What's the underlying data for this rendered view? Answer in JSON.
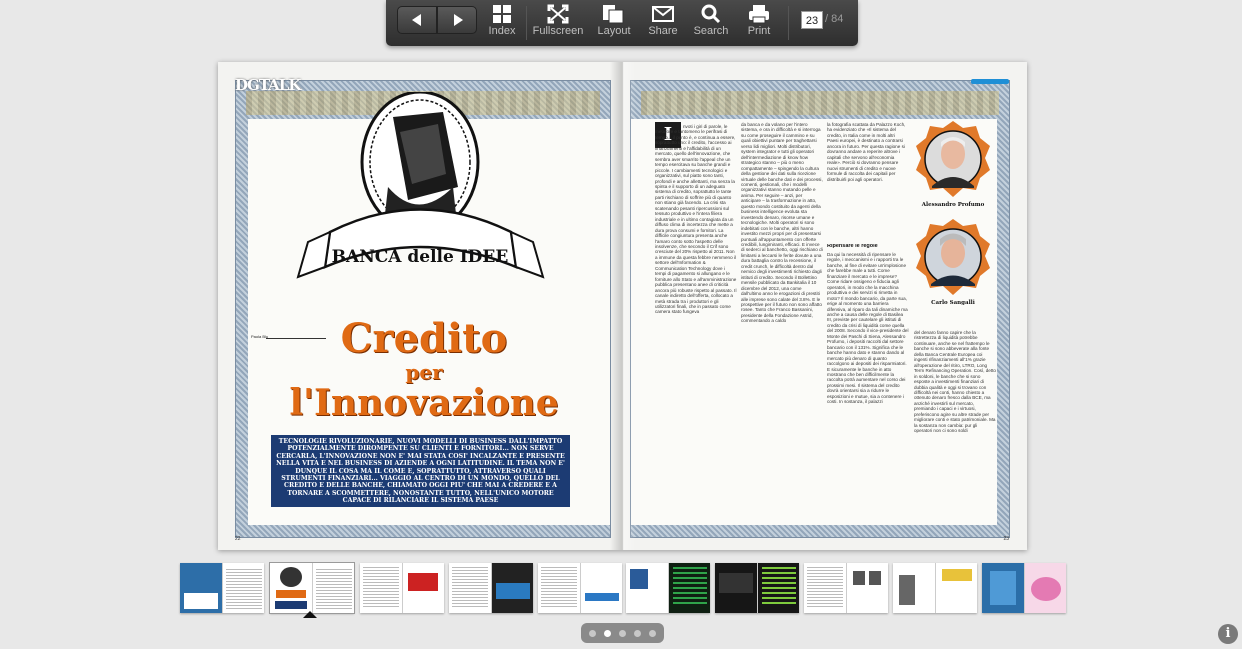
{
  "toolbar": {
    "index_label": "Index",
    "fullscreen_label": "Fullscreen",
    "layout_label": "Layout",
    "share_label": "Share",
    "search_label": "Search",
    "print_label": "Print",
    "current_page": "23",
    "total_pages": "/ 84"
  },
  "magazine": {
    "section_logo": "DGTALK",
    "left_page_number": "22",
    "right_page_number": "23",
    "illustration_banner": "BANCA delle IDEE",
    "author": "Paola Blu",
    "headline_line1": "Credito",
    "headline_line2": "per",
    "headline_line3": "l'Innovazione",
    "subhead": "TECNOLOGIE RIVOLUZIONARIE, NUOVI MODELLI DI BUSINESS DALL'IMPATTO POTENZIALMENTE DIROMPENTE SU CLIENTI E FORNITORI... NON SERVE CERCARLA, L'INNOVAZIONE NON E' MAI STATA COSI' INCALZANTE E PRESENTE NELLA VITA E NEL BUSINESS DI AZIENDE A OGNI LATITUDINE. IL TEMA NON E' DUNQUE IL COSA MA IL COME E, SOPRATTUTTO, ATTRAVERSO QUALI STRUMENTI FINANZIARI... VIAGGIO AL CENTRO DI UN MONDO, QUELLO DEL CREDITO E DELLE BANCHE, CHIAMATO OGGI PIU' CHE MAI A CREDERE E A TORNARE A SCOMMETTERE, NONOSTANTE TUTTO, NELL'UNICO MOTORE CAPACE DI RILANCIARE IL SISTEMA PAESE",
    "dropcap": "I",
    "col1": "nvoti i giri di parole, le metafore e tantomeno le perifrasi di tempo... il punto è, e continua a essere, soprattutto uno: il credito, l'accesso ai finanziamenti e l'affidabilità di un mercato, quello dell'innovazione, che sembra aver smarrito l'appeal che un tempo esercitava su banche grandi e piccole. I cambiamenti tecnologici e organizzativi, sul piatto sono tanti, profondi e anche allettanti, ma senza la spinta e il supporto di un adeguato sistema di credito, soprattutto le tante parti rischiano di soffrire più di quanto non stiano già facendo. La crisi sta scatenando pesanti ripercussioni sul tessuto produttivo e l'intera filiera industriale e in ultimo contagiata da un diffuso clima di incertezza che mette a dura prova consumi e fornitori. La difficile congiuntura presenta anche l'amaro conto sotto l'aspetto delle insolvenze, che secondo il Crif sono cresciute del 20% rispetto al 2011. Non a immune da questa febbre nemmeno il settore dell'Information & Communication Technology dove i tempi di pagamento si allungano e le forniture allo Stato e all'amministrazione pubblica presentano anee di criticità ancora più robuste rispetto al passato. Il canale indiretto dell'offerta, collocato a metà strada tra i produttori e gli utilizzatori finali, che in passato come camera stato fungeva",
    "col2": "da banca e da volano per l'intero sistema, e ora in difficoltà e si interroga su come proseguire il cammino e su quali obiettivi puntare per traghettarsi verso lidi migliori. Molti distributori, system integrator e tutti gli operatori dell'intermediazione di know how strategico stanno – più o meno compattamente – spingendo la cultura della gestione dei dati sulla ricezione virtuale delle banche dati e dei processi, comenti, gestionali, che i modelli organizzativi stanno mutando pelle e anima. Per seguire – anzi, per anticipare – la trasformazione in atto, questo mondo costituito da agenti della business intelligence evoluta sta investendo denaro, risorse umane e tecnologiche. Molti operatori si sono indebitati con le banche, altri hanno investito mezzi propri per di presentarsi puntuali all'appuntamento con offerte credibili, lungimiranti, efficaci. E invece di sederci al banchetto, oggi rischiano di limitarsi a leccarsi le ferite dovute a una dura battaglia contro la recessione, il credit crunch, le difficoltà dentro dal nemico degli investimenti richiesto dagli istituti di credito. Secondo il Bollettino mensile pubblicato da Bankitalia il 10 dicembre del 2012, una come dall'ultimo anno le erogazioni di prestiti alle imprese sono calate del 3.8%. E le prospettive per il futuro non sono affatto rosee. Tanto che Franco Bassanini, presidente della Fondazione Astrid, commentando a caldo",
    "col3": "la fotografia scattata da Palazzo Koch, ha evidenziato che «Il sistema del credito, in Italia come in molti altri Paesi europei, è destinato a contrarsi ancora in futuro. Per questa ragione si dovranno andare a reperire altrove i capitali che servono all'economia reale». Perciò si dovranno pensare nuovi strumenti di credito e nuove formule di raccolta dei capitali per distribuirli poi agli operatori.",
    "col3_head": "Ripensare le regole",
    "col3_b": "Da qui la necessità di ripensare le regole, i meccanismi e i rapporti tra le banche, al fine di evitare un'implosione che farebbe male a tutti. Come finanziare il mercato e le imprese? Come ridare ossigeno e fiducia agli operatori, in modo che la macchina produttiva e dei servizi si rimetta in moto? Il mondo bancario, da parte sua, erige al momento una barriera difensiva, al riparo da tali dinamiche ma anche a causa delle regole di Basilea III, previste per cautelare gli istituti di credito da crisi di liquidità come quella del 2008. Secondo il vice-presidente del Monte dei Paschi di Siena, Alessandro Profumo, i depositi raccolti dal settore bancario con il 131%. Significa che le banche hanno dato e stanno dando al mercato più denaro di quanto raccolgono ai depositi dei risparmiatori. E sicuramente le banche in atto mostrano che ben difficilmente la raccolta potrà aumentare nel corso dei prossimi mesi. Il sistema del credito dovrà orientarsi sia a ridurre le esposizioni e mutue, sia a contenere i costi. In sostanza, il palazzi",
    "col4": "del denaro fanno capire che la ristrettezza di liquidità potrebbe continuare, anche se nel frattempo le banche si sono abbeverate alla fonte della Banca Centrale Europea coi ingenti rifinanziamenti all'1% grazie all'operazione del ritiro, LTRO, Long Term Refinancing Operation. Così, detto in soldoni, le banche che si sono esposte a investimenti finanziari di dubbia qualità e oggi si trovano con difficoltà nei conti, hanno chiesto a ottenuto denaro fresco dalla BCE, ma anziché investirli sul mercato, premiando i capaci e i virtuosi, preferiscono agire su altre strade per migliorare conti e stato patrimoniale. Ma la sostanza non cambia: pur gli operatori non ci sono soldi",
    "portrait1_name": "Alessandro Profumo",
    "portrait2_name": "Carlo Sangalli"
  },
  "thumbnails": [
    "Pagine 20-21",
    "Pagine 22-23",
    "Pagine 24-25",
    "Pagine 26-27",
    "Pagine 28-29",
    "Pagine 30-31",
    "Pagine 32-33",
    "Pagine 34-35",
    "Pagine 36-37",
    "Pagine 38-39",
    "Pagine 40-41"
  ],
  "pager": {
    "total": 5,
    "active": 2
  },
  "info_label": "i",
  "colors": {
    "accent": "#e06a14",
    "navy": "#1c3b73",
    "toolbar": "#3a3a3a",
    "background": "#e8e8e8"
  }
}
